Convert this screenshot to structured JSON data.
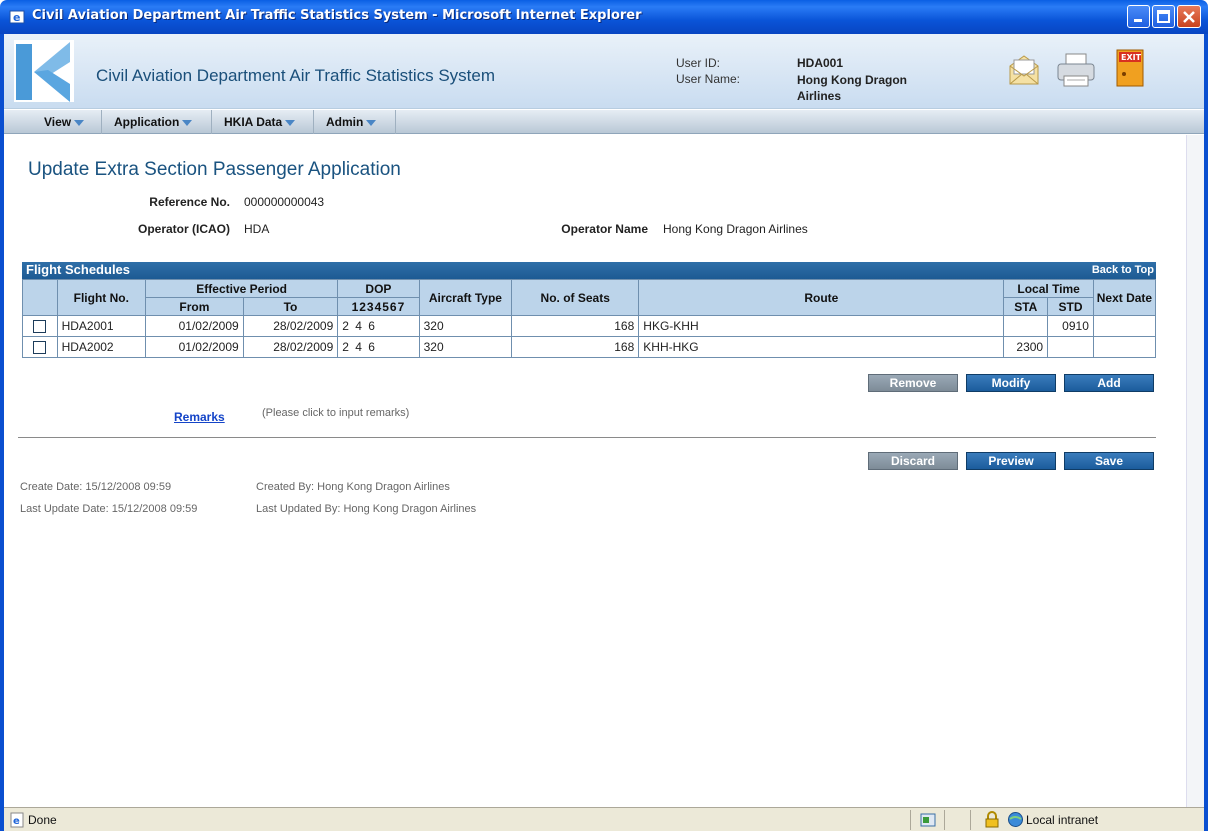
{
  "window": {
    "title": "Civil Aviation Department Air Traffic Statistics System - Microsoft Internet Explorer"
  },
  "header": {
    "app_title": "Civil Aviation Department Air Traffic Statistics System",
    "user_id_label": "User ID:",
    "user_id": "HDA001",
    "user_name_label": "User Name:",
    "user_name": "Hong Kong Dragon Airlines",
    "icons": [
      "mail-icon",
      "printer-icon",
      "exit-icon"
    ],
    "exit_label": "EXIT"
  },
  "menu": {
    "items": [
      {
        "label": "View"
      },
      {
        "label": "Application"
      },
      {
        "label": "HKIA Data"
      },
      {
        "label": "Admin"
      }
    ]
  },
  "page": {
    "title": "Update Extra Section Passenger Application",
    "reference_label": "Reference No.",
    "reference_value": "000000000043",
    "operator_icao_label": "Operator (ICAO)",
    "operator_icao_value": "HDA",
    "operator_name_label": "Operator Name",
    "operator_name_value": "Hong Kong Dragon Airlines"
  },
  "flight_schedules": {
    "title": "Flight Schedules",
    "back_to_top": "Back to Top",
    "headers": {
      "flight_no": "Flight No.",
      "effective_period": "Effective Period",
      "from": "From",
      "to": "To",
      "dop": "DOP",
      "dop_sub": "1234567",
      "aircraft_type": "Aircraft Type",
      "seats": "No. of Seats",
      "route": "Route",
      "local_time": "Local Time",
      "sta": "STA",
      "std": "STD",
      "next_date": "Next Date"
    },
    "rows": [
      {
        "flight_no": "HDA2001",
        "from": "01/02/2009",
        "to": "28/02/2009",
        "dop": "2 4 6",
        "aircraft": "320",
        "seats": "168",
        "route": "HKG-KHH",
        "sta": "",
        "std": "0910",
        "next": ""
      },
      {
        "flight_no": "HDA2002",
        "from": "01/02/2009",
        "to": "28/02/2009",
        "dop": "2 4 6",
        "aircraft": "320",
        "seats": "168",
        "route": "KHH-HKG",
        "sta": "2300",
        "std": "",
        "next": ""
      }
    ],
    "buttons": {
      "remove": "Remove",
      "modify": "Modify",
      "add": "Add"
    }
  },
  "remarks": {
    "link": "Remarks",
    "hint": "(Please click to input remarks)"
  },
  "actions": {
    "discard": "Discard",
    "preview": "Preview",
    "save": "Save"
  },
  "meta": {
    "create_date": "Create Date: 15/12/2008 09:59",
    "created_by": "Created By: Hong Kong Dragon Airlines",
    "last_update_date": "Last Update Date: 15/12/2008 09:59",
    "last_updated_by": "Last Updated By: Hong Kong Dragon Airlines"
  },
  "statusbar": {
    "status": "Done",
    "zone": "Local intranet"
  },
  "colors": {
    "accent": "#1d5a93",
    "table_header": "#bcd4ea",
    "title_text": "#1a5380"
  }
}
